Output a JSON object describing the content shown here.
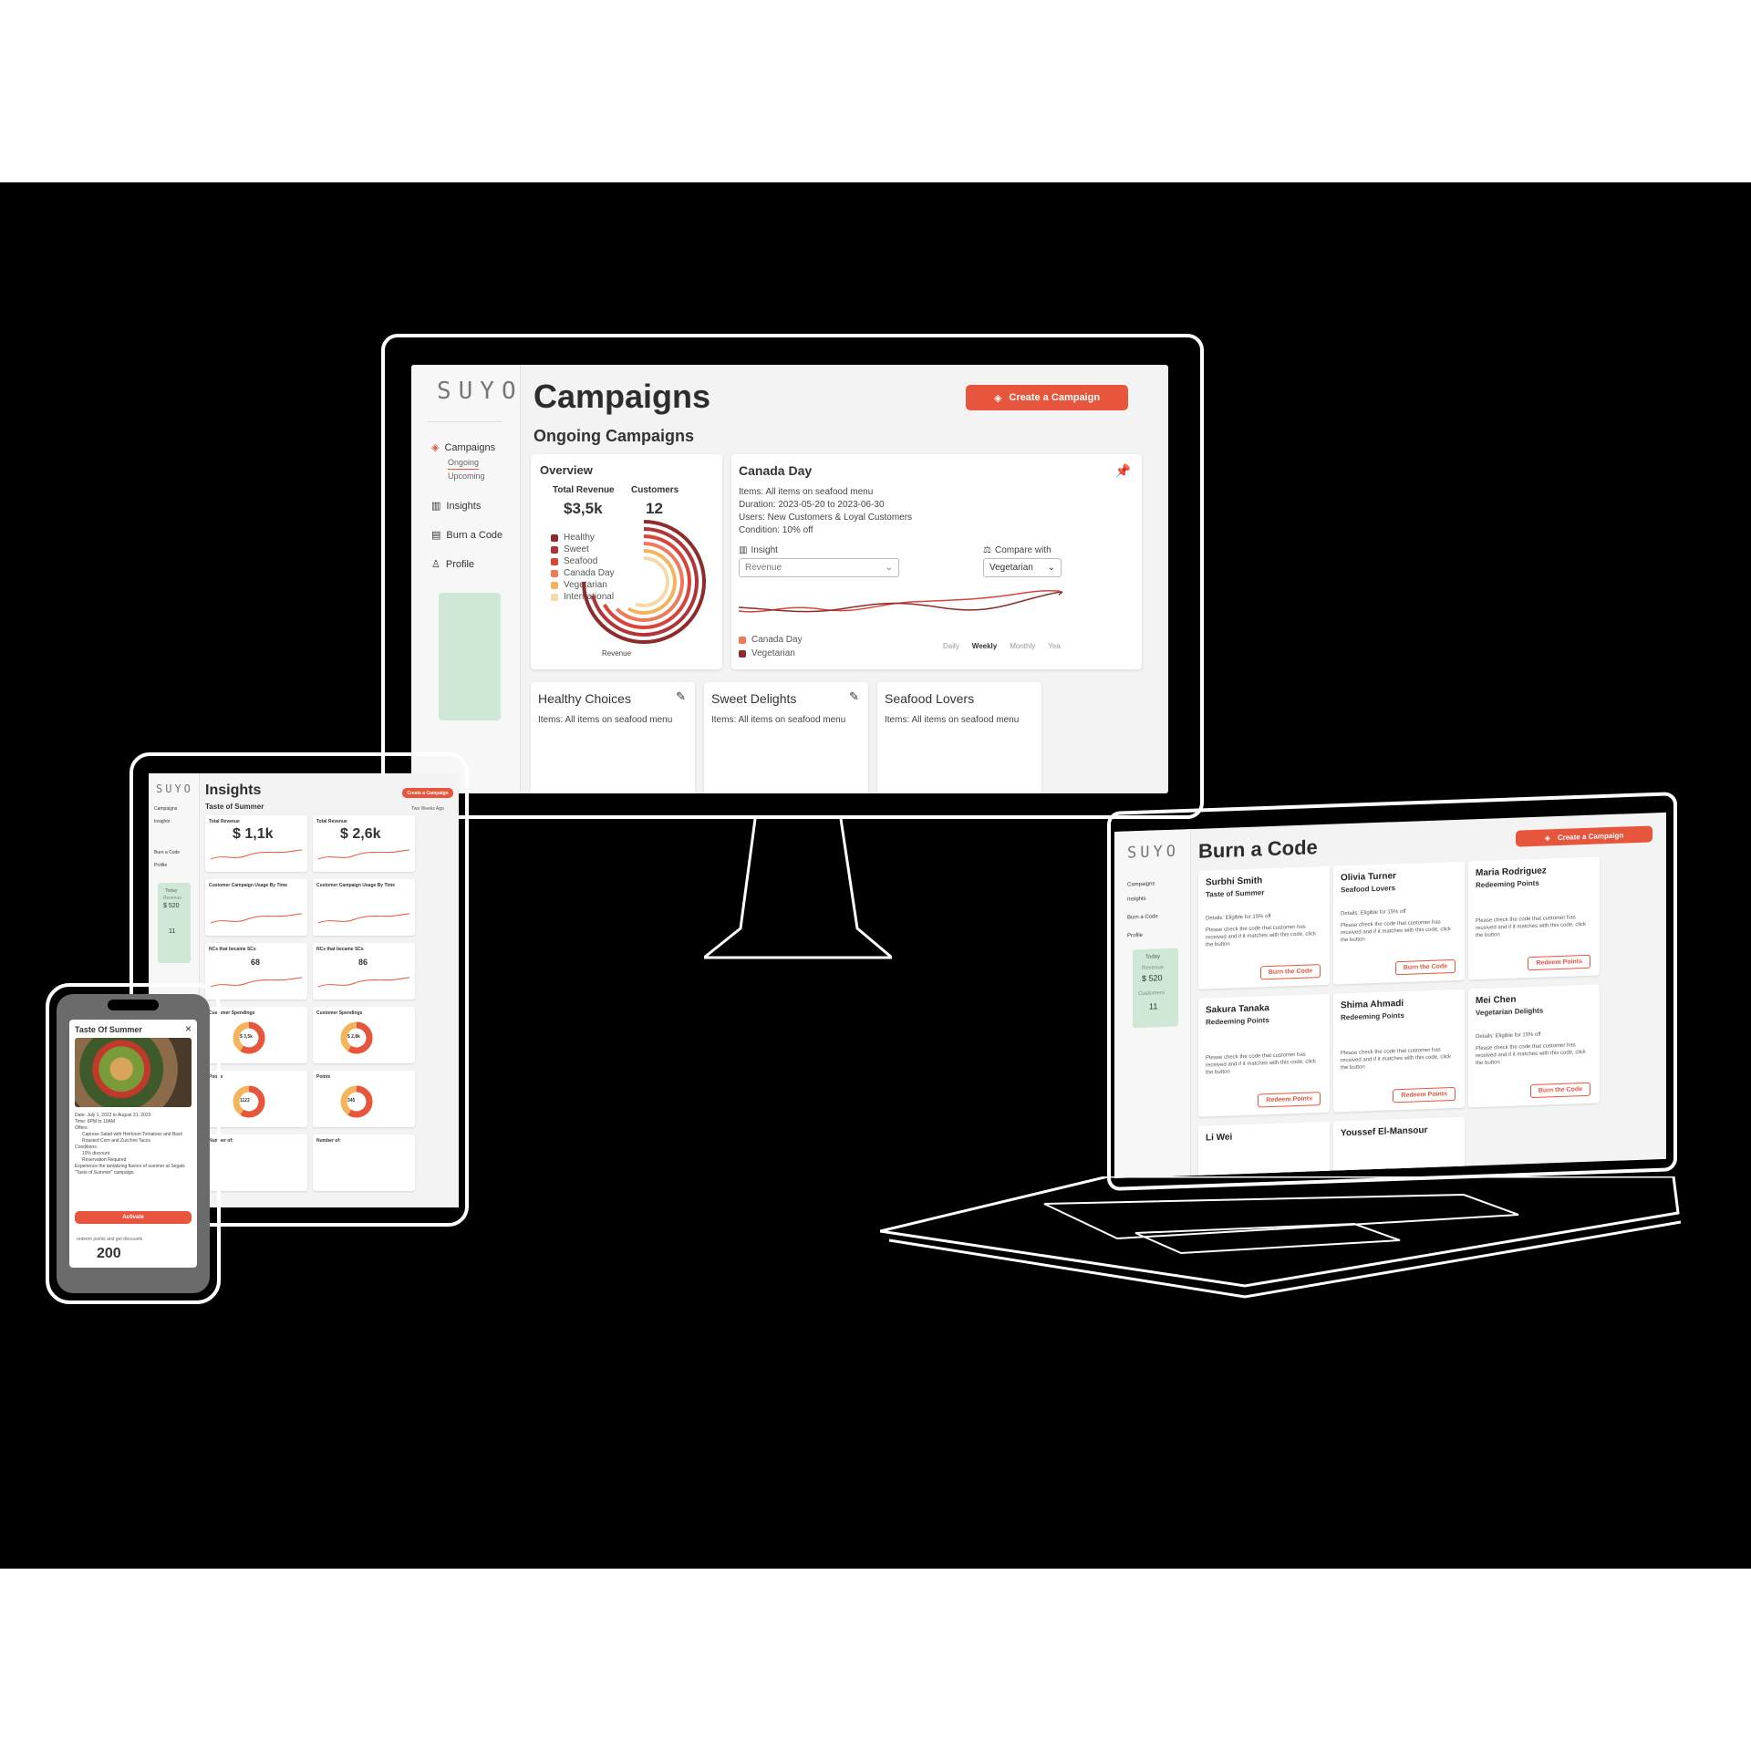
{
  "colors": {
    "accent": "#e8553d",
    "dark_red": "#8e2b2b",
    "green_panel": "#cfe8d5"
  },
  "monitor": {
    "logo": "SUYO",
    "nav": {
      "campaigns": "Campaigns",
      "ongoing": "Ongoing",
      "upcoming": "Upcoming",
      "insights": "Insights",
      "burn_code": "Burn a Code",
      "profile": "Profile"
    },
    "title": "Campaigns",
    "subtitle": "Ongoing Campaigns",
    "create_button": "Create a Campaign",
    "overview": {
      "title": "Overview",
      "total_revenue_label": "Total Revenue",
      "total_revenue": "$3,5k",
      "customers_label": "Customers",
      "customers": "12",
      "legend": [
        {
          "label": "Healthy",
          "color": "#8e2b2b"
        },
        {
          "label": "Sweet",
          "color": "#b0353a"
        },
        {
          "label": "Seafood",
          "color": "#d8443a"
        },
        {
          "label": "Canada Day",
          "color": "#ee7a5a"
        },
        {
          "label": "Vegetarian",
          "color": "#f3b45c"
        },
        {
          "label": "International",
          "color": "#f6d9a8"
        }
      ],
      "chart_caption": "Revenue"
    },
    "canada_day": {
      "title": "Canada Day",
      "items": "Items: All items on seafood menu",
      "duration": "Duration: 2023-05-20 to 2023-06-30",
      "users": "Users: New Customers & Loyal Customers",
      "condition": "Condition: 10% off",
      "insight_label": "Insight",
      "insight_value": "Revenue",
      "compare_label": "Compare with",
      "compare_value": "Vegetarian",
      "legend": [
        "Canada Day",
        "Vegetarian"
      ],
      "periods": [
        "Daily",
        "Weekly",
        "Monthly",
        "Yea"
      ]
    },
    "small_cards": [
      {
        "title": "Healthy Choices",
        "items": "Items: All items on seafood menu"
      },
      {
        "title": "Sweet Delights",
        "items": "Items: All items on seafood menu"
      },
      {
        "title": "Seafood Lovers",
        "items": "Items: All items on seafood menu"
      }
    ]
  },
  "tablet": {
    "logo": "SUYO",
    "title": "Insights",
    "campaign_select": "Taste of Summer",
    "create_button": "Create a Campaign",
    "date_range": "Two Weeks Ago",
    "nav": [
      "Campaigns",
      "Insights",
      "Burn a Code",
      "Profile"
    ],
    "today": {
      "label": "Today",
      "revenue_label": "Revenue",
      "revenue": "$ 520",
      "customers": "11"
    },
    "cards": [
      {
        "label": "Total Revenue",
        "value": "$ 1,1k"
      },
      {
        "label": "Total Revenue",
        "value": "$ 2,6k"
      },
      {
        "label": "Customer Campaign Usage By Time",
        "value": ""
      },
      {
        "label": "Customer Campaign Usage By Time",
        "value": ""
      },
      {
        "label": "NCs that became SCs",
        "value": "68"
      },
      {
        "label": "NCs that became SCs",
        "value": "86"
      },
      {
        "label": "Customer Spendings",
        "value": "$ 3,5k"
      },
      {
        "label": "Customer Spendings",
        "value": "$ 2,8k"
      },
      {
        "label": "Points",
        "value": "1122"
      },
      {
        "label": "Points",
        "value": "345"
      },
      {
        "label": "Number of:",
        "value": ""
      },
      {
        "label": "Number of:",
        "value": ""
      }
    ]
  },
  "phone": {
    "modal_title": "Taste Of Summer",
    "close": "×",
    "date": "Date: July 1, 2023 to August 31, 2023",
    "time": "Time: 6PM to 10AM",
    "offers_label": "Offers:",
    "offers": [
      "Caprese Salad with Heirloom Tomatoes and Basil",
      "Roasted Corn and Zucchini Tacos"
    ],
    "conditions_label": "Conditions:",
    "conditions": [
      "10% discount",
      "Reservation Required"
    ],
    "description": "Experience the tantalizing flavors of summer at Segals \"Taste of Summer\" campaign.",
    "activate_button": "Activate",
    "footer_text": "redeem points and get discounts",
    "points": "200"
  },
  "laptop": {
    "logo": "SUYO",
    "title": "Burn a Code",
    "create_button": "Create a Campaign",
    "nav": [
      "Campaigns",
      "Insights",
      "Burn a Code",
      "Profile"
    ],
    "today": {
      "label": "Today",
      "revenue_label": "Revenue",
      "revenue": "$ 520",
      "customers_label": "Customers",
      "customers": "11"
    },
    "check_text": "Please check the code that customer has received and if it matches with this code, click the button",
    "codes": [
      {
        "name": "Surbhi Smith",
        "campaign": "Taste of Summer",
        "detail": "Details: Eligible for 15% off",
        "button": "Burn the Code"
      },
      {
        "name": "Olivia Turner",
        "campaign": "Seafood Lovers",
        "detail": "Details: Eligible for 15% off",
        "button": "Burn the Code"
      },
      {
        "name": "Maria Rodriguez",
        "campaign": "Redeeming Points",
        "detail": "",
        "button": "Redeem Points"
      },
      {
        "name": "Sakura Tanaka",
        "campaign": "Redeeming Points",
        "detail": "",
        "button": "Redeem Points"
      },
      {
        "name": "Shima Ahmadi",
        "campaign": "Redeeming Points",
        "detail": "",
        "button": "Redeem Points"
      },
      {
        "name": "Mei Chen",
        "campaign": "Vegetarian Delights",
        "detail": "Details: Eligible for 15% off",
        "button": "Burn the Code"
      },
      {
        "name": "Li Wei",
        "campaign": "",
        "detail": "",
        "button": ""
      },
      {
        "name": "Youssef El-Mansour",
        "campaign": "",
        "detail": "",
        "button": ""
      }
    ]
  }
}
